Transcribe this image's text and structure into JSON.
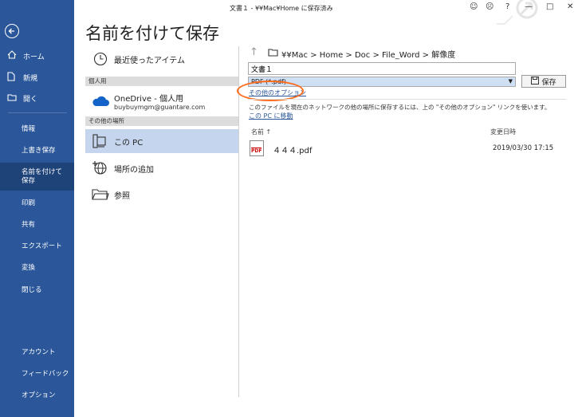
{
  "window": {
    "title": "文書１ - ¥¥Mac¥Home に保存済み",
    "controls": {
      "smile": "☺",
      "frown": "☹",
      "help": "?",
      "minimize": "—",
      "maximize": "□",
      "close": "✕"
    }
  },
  "sidebar": {
    "top_items": [
      {
        "icon": "home-icon",
        "label": "ホーム"
      },
      {
        "icon": "new-document-icon",
        "label": "新規"
      },
      {
        "icon": "open-folder-icon",
        "label": "開く"
      }
    ],
    "menu_items": [
      "情報",
      "上書き保存",
      "名前を付けて保存",
      "印刷",
      "共有",
      "エクスポート",
      "変換",
      "閉じる"
    ],
    "active": "名前を付けて保存",
    "bottom_items": [
      "アカウント",
      "フィードバック",
      "オプション"
    ]
  },
  "page": {
    "title": "名前を付けて保存"
  },
  "locations": {
    "recent": "最近使ったアイテム",
    "personal_header": "個人用",
    "onedrive_name": "OneDrive - 個人用",
    "onedrive_email": "buybuymgm@guantare.com",
    "other_header": "その他の場所",
    "this_pc": "この PC",
    "add_place": "場所の追加",
    "browse": "参照"
  },
  "save_panel": {
    "path": "¥¥Mac > Home > Doc > File_Word > 解像度",
    "filename": "文書１",
    "filetype": "PDF (*.pdf)",
    "save_label": "保存",
    "more_options": "その他のオプション",
    "info": "このファイルを現在のネットワークの他の場所に保存するには、上の \"その他のオプション\" リンクを使います。",
    "move_to_pc": "この PC に移動",
    "col_name": "名前 ↑",
    "col_date": "変更日時",
    "files": [
      {
        "name": "４４４.pdf",
        "modified": "2019/03/30 17:15",
        "icon_label": "PDF"
      }
    ]
  },
  "colors": {
    "sidebar": "#2b579a",
    "sidebar_active": "#1e4379",
    "selection": "#c5d5ee",
    "highlight": "#ff6b1a"
  }
}
